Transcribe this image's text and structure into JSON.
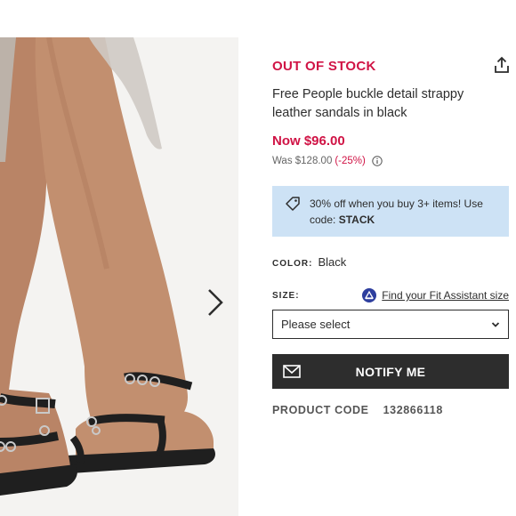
{
  "product": {
    "stock_status": "OUT OF STOCK",
    "title": "Free People buckle detail strappy leather sandals in black",
    "price_now": "Now $96.00",
    "was_label": "Was $128.00",
    "discount": "(-25%)",
    "promo_text": "30% off when you buy 3+ items! Use code:",
    "promo_code": "STACK",
    "color_label": "COLOR:",
    "color_value": "Black",
    "size_label": "SIZE:",
    "fit_link": "Find your Fit Assistant size",
    "size_select": "Please select",
    "notify_label": "NOTIFY ME",
    "code_label": "PRODUCT CODE",
    "code_value": "132866118"
  },
  "icons": {
    "share": "share-icon",
    "next": "chevron-right-icon",
    "info": "info-icon",
    "tag": "tag-icon",
    "fit": "fit-assistant-icon",
    "dropdown": "chevron-down-icon",
    "mail": "mail-icon"
  },
  "colors": {
    "accent_red": "#d01345",
    "promo_bg": "#cde2f5",
    "button_dark": "#2d2d2d"
  }
}
